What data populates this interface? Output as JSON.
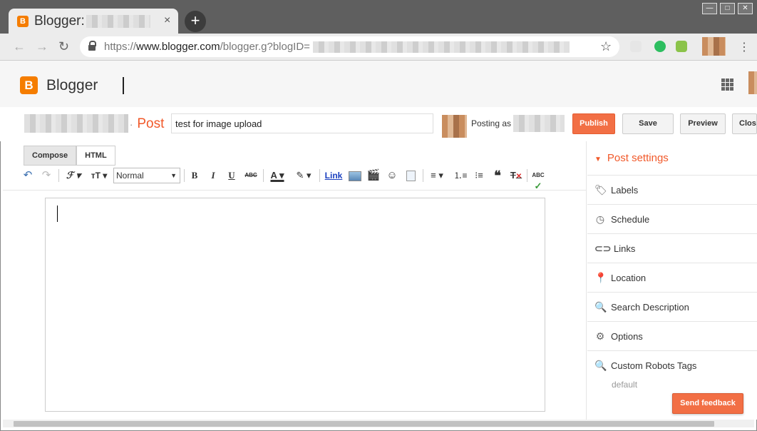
{
  "browser": {
    "tab_title": "Blogger:",
    "tab_favicon": "B",
    "tab_close": "×",
    "new_tab": "+",
    "window_buttons": [
      "—",
      "□",
      "✕"
    ],
    "url_prefix": "https://",
    "url_domain": "www.blogger.com",
    "url_path": "/blogger.g?blogID=",
    "nav_icons": [
      "back-icon",
      "forward-icon",
      "reload-icon"
    ]
  },
  "app": {
    "brand": "Blogger",
    "logo_letter": "B",
    "brand_color": "#f57d00",
    "accent_color": "#f1592a"
  },
  "post_header": {
    "separator": "·",
    "post_label": "Post",
    "title_value": "test for image upload",
    "posting_as": "Posting as",
    "buttons": {
      "publish": "Publish",
      "save": "Save",
      "preview": "Preview",
      "close": "Clos"
    }
  },
  "editor": {
    "mode_tabs": [
      "Compose",
      "HTML"
    ],
    "active_mode": "Compose",
    "format_select": "Normal",
    "link_label": "Link",
    "bold": "B",
    "italic": "I",
    "underline": "U",
    "strike": "ABC",
    "spell": "ABC"
  },
  "sidebar": {
    "heading": "Post settings",
    "items": [
      {
        "label": "Labels",
        "icon": "tag-icon"
      },
      {
        "label": "Schedule",
        "icon": "clock-icon"
      },
      {
        "label": "Links",
        "icon": "link-icon"
      },
      {
        "label": "Location",
        "icon": "location-pin-icon"
      },
      {
        "label": "Search Description",
        "icon": "search-icon"
      },
      {
        "label": "Options",
        "icon": "gear-icon"
      },
      {
        "label": "Custom Robots Tags",
        "icon": "search-icon"
      }
    ],
    "robots_default": "default"
  },
  "feedback": {
    "label": "Send feedback"
  }
}
